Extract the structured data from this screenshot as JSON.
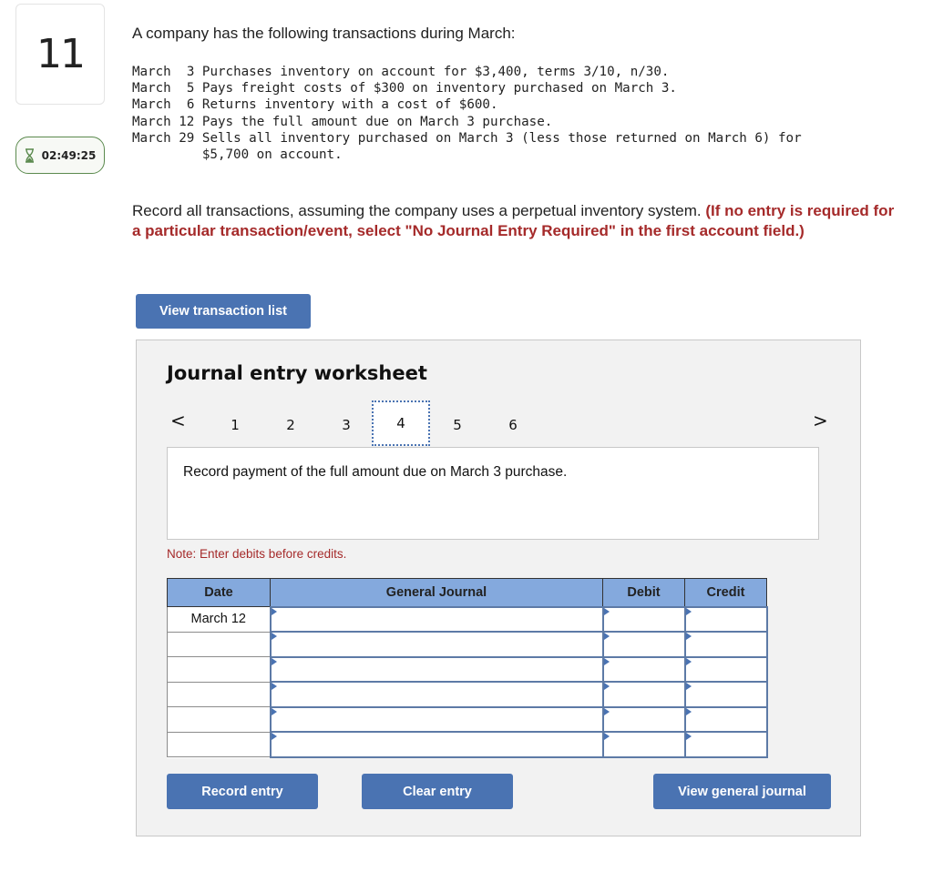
{
  "question": {
    "number": "11",
    "timer": "02:49:25",
    "timer_icon": "hourglass-icon",
    "intro": "A company has the following transactions during March:",
    "transactions": [
      {
        "month": "March",
        "day": "3",
        "text": "Purchases inventory on account for $3,400, terms 3/10, n/30."
      },
      {
        "month": "March",
        "day": "5",
        "text": "Pays freight costs of $300 on inventory purchased on March 3."
      },
      {
        "month": "March",
        "day": "6",
        "text": "Returns inventory with a cost of $600."
      },
      {
        "month": "March",
        "day": "12",
        "text": "Pays the full amount due on March 3 purchase."
      },
      {
        "month": "March",
        "day": "29",
        "text": "Sells all inventory purchased on March 3 (less those returned on March 6) for\n$5,700 on account."
      }
    ],
    "instruction": "Record all transactions, assuming the company uses a perpetual inventory system.",
    "instruction_note": "(If no entry is required for a particular transaction/event, select \"No Journal Entry Required\" in the first account field.)",
    "view_transaction_list_label": "View transaction list"
  },
  "worksheet": {
    "title": "Journal entry worksheet",
    "prev_icon": "chevron-left-icon",
    "next_icon": "chevron-right-icon",
    "prev_glyph": "<",
    "next_glyph": ">",
    "pages": [
      "1",
      "2",
      "3",
      "4",
      "5",
      "6"
    ],
    "active_page": "4",
    "description": "Record payment of the full amount due on March 3 purchase.",
    "note": "Note: Enter debits before credits.",
    "table": {
      "headers": {
        "date": "Date",
        "account": "General Journal",
        "debit": "Debit",
        "credit": "Credit"
      },
      "rows": [
        {
          "date": "March 12",
          "account": "",
          "debit": "",
          "credit": ""
        },
        {
          "date": "",
          "account": "",
          "debit": "",
          "credit": ""
        },
        {
          "date": "",
          "account": "",
          "debit": "",
          "credit": ""
        },
        {
          "date": "",
          "account": "",
          "debit": "",
          "credit": ""
        },
        {
          "date": "",
          "account": "",
          "debit": "",
          "credit": ""
        },
        {
          "date": "",
          "account": "",
          "debit": "",
          "credit": ""
        }
      ]
    },
    "buttons": {
      "record": "Record entry",
      "clear": "Clear entry",
      "view_general_journal": "View general journal"
    }
  },
  "colors": {
    "button_blue": "#4a73b2",
    "header_blue": "#84a9dd",
    "note_red": "#a52a2a",
    "timer_green": "#5b8a4e"
  }
}
